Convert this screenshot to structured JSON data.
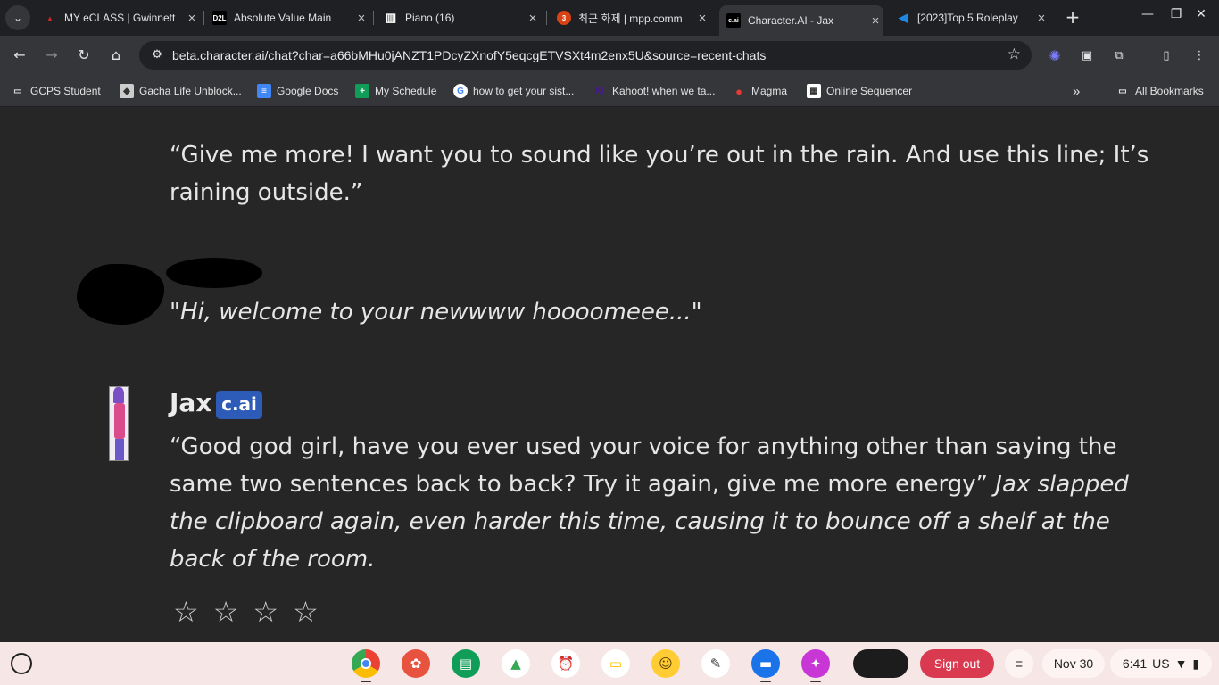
{
  "tabs": [
    {
      "title": "MY eCLASS | Gwinnett",
      "icon": "eclass-icon",
      "color": "#c62828"
    },
    {
      "title": "Absolute Value Main",
      "icon": "d2l-icon",
      "color": "#000000"
    },
    {
      "title": "Piano (16)",
      "icon": "piano-icon",
      "color": "#ffffff"
    },
    {
      "title": "최근 화제 | mpp.comm",
      "icon": "mpp-icon",
      "color": "#d84315"
    },
    {
      "title": "Character.AI - Jax",
      "icon": "cai-icon",
      "color": "#000000",
      "active": true
    },
    {
      "title": "[2023]Top 5 Roleplay",
      "icon": "arrow-icon",
      "color": "#1e88e5"
    }
  ],
  "favicon_labels": {
    "d2l": "D2L",
    "cai": "c.ai",
    "mpp": "3"
  },
  "address_bar": {
    "url": "beta.character.ai/chat?char=a66bMHu0jANZT1PDcyZXnofY5eqcgETVSXt4m2enx5U&source=recent-chats"
  },
  "bookmarks": [
    {
      "label": "GCPS Student",
      "icon": "folder-link-icon"
    },
    {
      "label": "Gacha Life Unblock...",
      "icon": "gacha-icon"
    },
    {
      "label": "Google Docs",
      "icon": "docs-icon"
    },
    {
      "label": "My Schedule",
      "icon": "sheets-icon"
    },
    {
      "label": "how to get your sist...",
      "icon": "google-icon"
    },
    {
      "label": "Kahoot! when we ta...",
      "icon": "kahoot-icon"
    },
    {
      "label": "Magma",
      "icon": "magma-icon"
    },
    {
      "label": "Online Sequencer",
      "icon": "sequencer-icon"
    }
  ],
  "all_bookmarks": "All Bookmarks",
  "chat": {
    "user_message": "“Give me more! I want you to sound like you’re out in the rain. And use this line; It’s raining outside.”",
    "user_reply": "\"Hi, welcome to your newwww hoooomeee...\"",
    "character_name": "Jax",
    "character_badge": "c.ai",
    "character_message_speech": "“Good god girl, have you ever used your voice for anything other than saying the same two sentences back to back? Try it again, give me more energy”",
    "character_message_action": "Jax slapped the clipboard again, even harder this time, causing it to bounce off a shelf at the back of the room.",
    "rating_stars": [
      "☆",
      "☆",
      "☆",
      "☆"
    ]
  },
  "shelf": {
    "apps": [
      "chrome-icon",
      "palette-icon",
      "classroom-icon",
      "drive-icon",
      "clock-icon",
      "keep-icon",
      "emoji-icon",
      "canvas-icon",
      "files-icon",
      "gallery-icon"
    ],
    "sign_out": "Sign out",
    "date": "Nov 30",
    "time": "6:41",
    "locale": "US"
  }
}
